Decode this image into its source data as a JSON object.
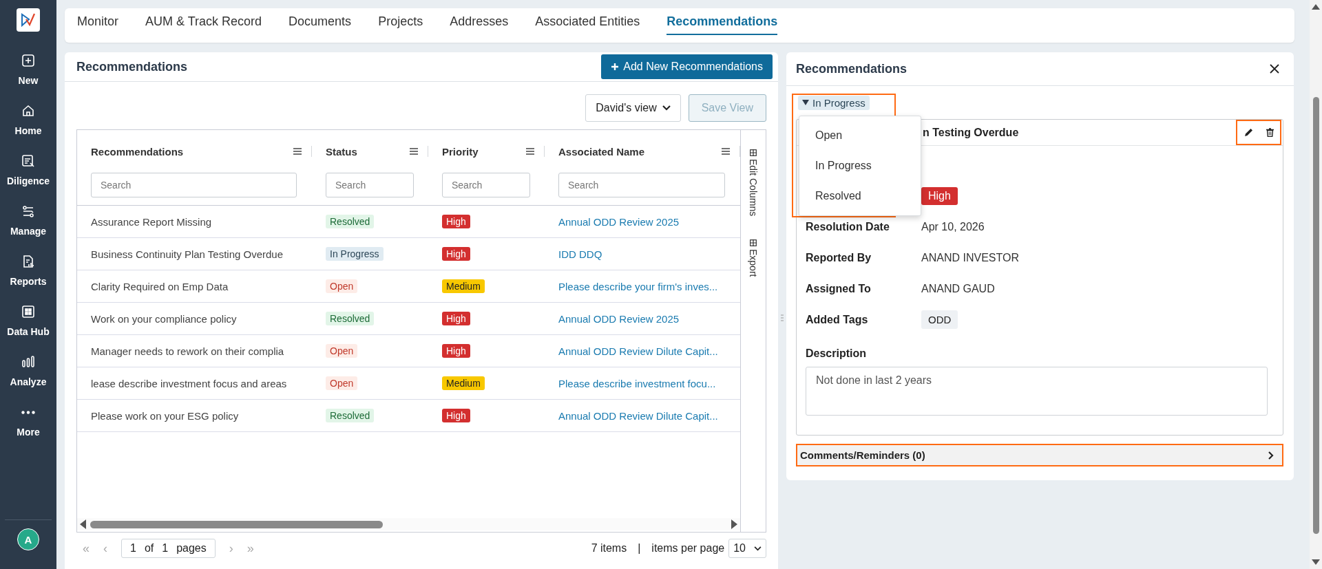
{
  "sidebar": {
    "items": [
      {
        "label": "New"
      },
      {
        "label": "Home"
      },
      {
        "label": "Diligence"
      },
      {
        "label": "Manage"
      },
      {
        "label": "Reports"
      },
      {
        "label": "Data Hub"
      },
      {
        "label": "Analyze"
      },
      {
        "label": "More"
      }
    ],
    "avatar": "A"
  },
  "tabs": [
    {
      "label": "Monitor",
      "selected": false
    },
    {
      "label": "AUM & Track Record",
      "selected": false
    },
    {
      "label": "Documents",
      "selected": false
    },
    {
      "label": "Projects",
      "selected": false
    },
    {
      "label": "Addresses",
      "selected": false
    },
    {
      "label": "Associated Entities",
      "selected": false
    },
    {
      "label": "Recommendations",
      "selected": true
    }
  ],
  "list_panel": {
    "title": "Recommendations",
    "add_button": "Add New Recommendations",
    "view_select": "David's view",
    "save_view": {
      "label": "Save View",
      "disabled": true
    },
    "table": {
      "columns": [
        {
          "label": "Recommendations",
          "placeholder": "Search"
        },
        {
          "label": "Status",
          "placeholder": "Search"
        },
        {
          "label": "Priority",
          "placeholder": "Search"
        },
        {
          "label": "Associated Name",
          "placeholder": "Search"
        }
      ],
      "side_tools": [
        "Edit Columns",
        "Export"
      ],
      "rows": [
        {
          "recommendation": "Assurance Report Missing",
          "status": {
            "label": "Resolved",
            "kind": "resolved"
          },
          "priority": {
            "label": "High",
            "kind": "high"
          },
          "associated_name": "Annual ODD Review 2025"
        },
        {
          "recommendation": "Business Continuity Plan Testing Overdue",
          "status": {
            "label": "In Progress",
            "kind": "in_progress"
          },
          "priority": {
            "label": "High",
            "kind": "high"
          },
          "associated_name": "IDD DDQ"
        },
        {
          "recommendation": "Clarity Required on Emp Data",
          "status": {
            "label": "Open",
            "kind": "open"
          },
          "priority": {
            "label": "Medium",
            "kind": "medium"
          },
          "associated_name": "Please describe your firm's inves..."
        },
        {
          "recommendation": "Work on your compliance policy",
          "status": {
            "label": "Resolved",
            "kind": "resolved"
          },
          "priority": {
            "label": "High",
            "kind": "high"
          },
          "associated_name": "Annual ODD Review 2025"
        },
        {
          "recommendation": "Manager needs to rework on their complia",
          "status": {
            "label": "Open",
            "kind": "open"
          },
          "priority": {
            "label": "High",
            "kind": "high"
          },
          "associated_name": "Annual ODD Review Dilute Capit..."
        },
        {
          "recommendation": "lease describe investment focus and areas",
          "status": {
            "label": "Open",
            "kind": "open"
          },
          "priority": {
            "label": "Medium",
            "kind": "medium"
          },
          "associated_name": "Please describe investment focu..."
        },
        {
          "recommendation": "Please work on your ESG policy",
          "status": {
            "label": "Resolved",
            "kind": "resolved"
          },
          "priority": {
            "label": "High",
            "kind": "high"
          },
          "associated_name": "Annual ODD Review Dilute Capit..."
        }
      ]
    },
    "pagination": {
      "first": "«",
      "prev": "‹",
      "page": "1",
      "of": "of",
      "total": "1",
      "pages": "pages",
      "next": "›",
      "last": "»",
      "items": "7 items",
      "separator": "|",
      "per_page_label": "items per page",
      "per_page": "10"
    }
  },
  "detail_panel": {
    "title": "Recommendations",
    "status_chip": "In Progress",
    "status_menu": [
      {
        "label": "Open"
      },
      {
        "label": "In Progress"
      },
      {
        "label": "Resolved"
      }
    ],
    "card_title": "n Testing Overdue",
    "priority": {
      "label": "High",
      "kind": "high"
    },
    "fields": [
      {
        "label": "Resolution Date",
        "value": "Apr 10, 2026",
        "kind": "text"
      },
      {
        "label": "Reported By",
        "value": "ANAND INVESTOR",
        "kind": "text"
      },
      {
        "label": "Assigned To",
        "value": "ANAND GAUD",
        "kind": "text"
      },
      {
        "label": "Added Tags",
        "value": "ODD",
        "kind": "tag"
      }
    ],
    "description_label": "Description",
    "description": "Not done in last 2 years",
    "comments": "Comments/Reminders (0)"
  }
}
